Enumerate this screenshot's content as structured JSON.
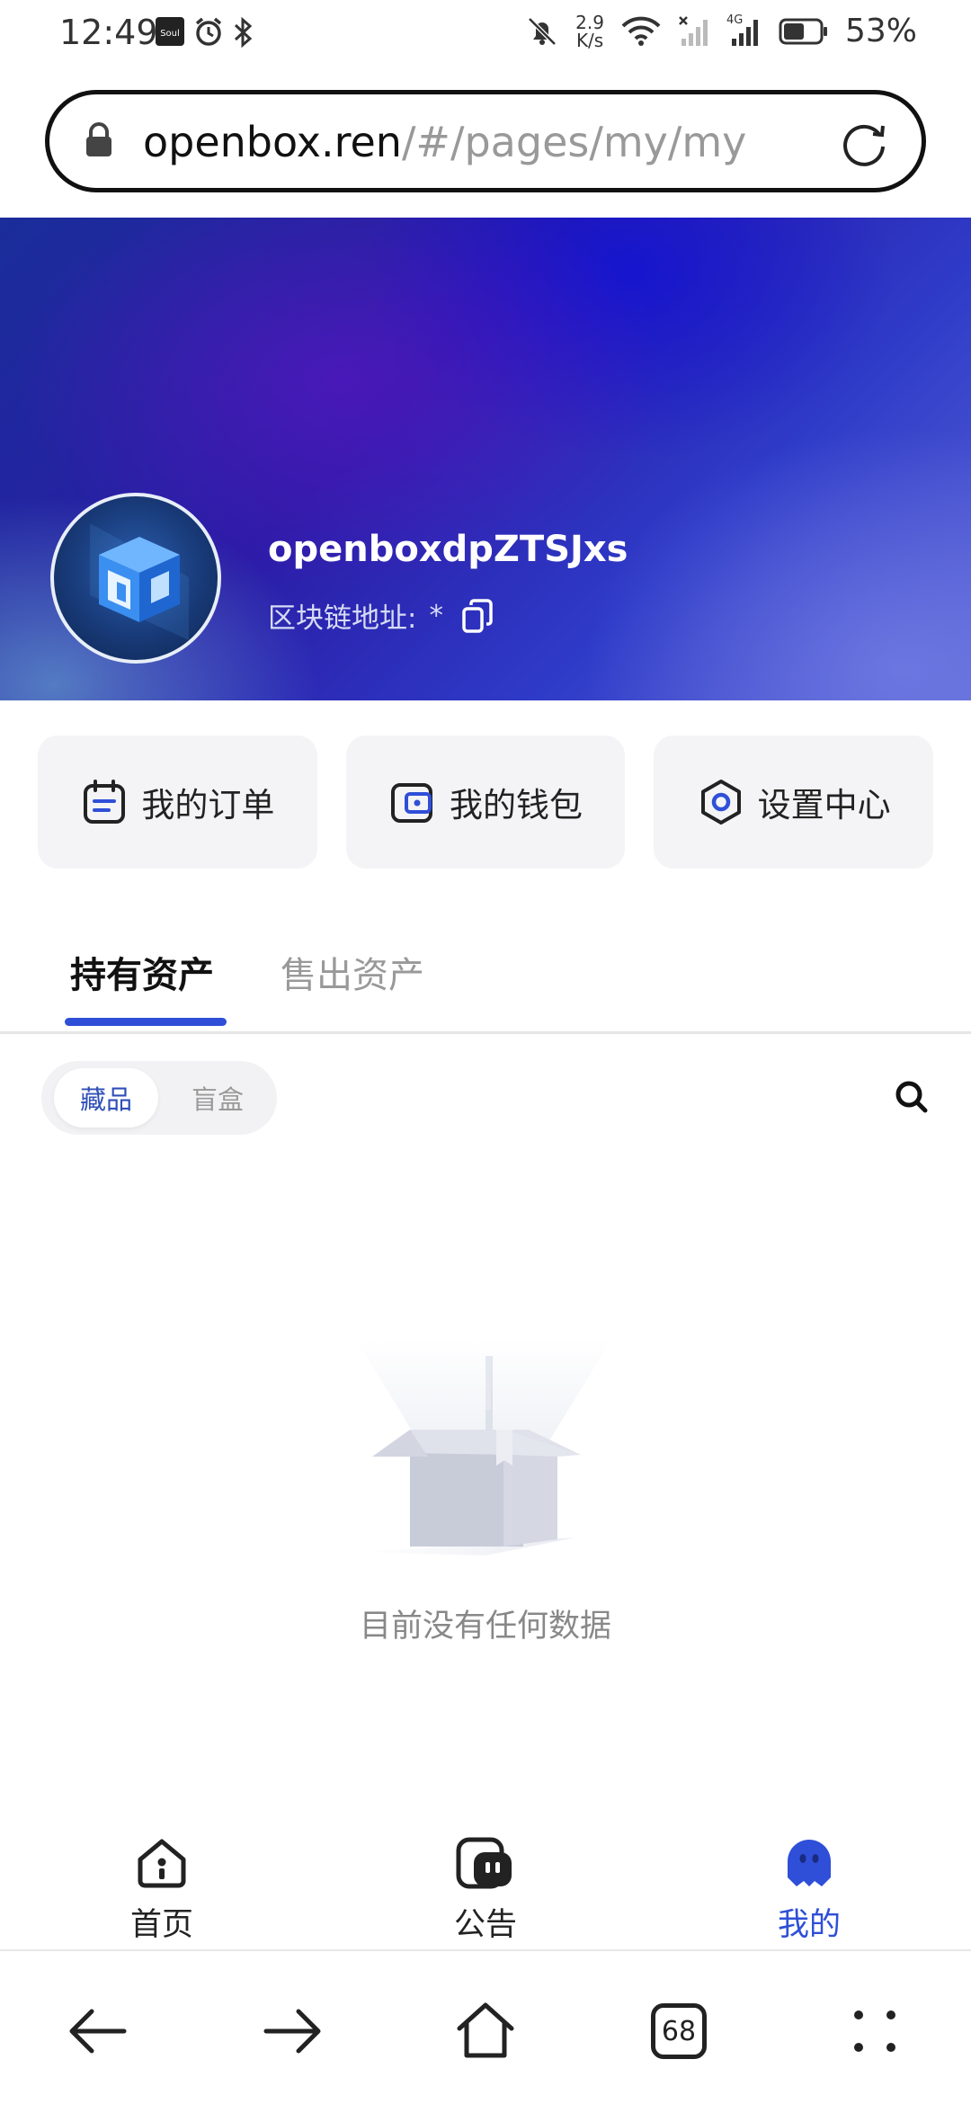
{
  "status_bar": {
    "time": "12:49",
    "net_speed_value": "2.9",
    "net_speed_unit": "K/s",
    "signal_label": "4G",
    "battery_percent": "53%"
  },
  "browser": {
    "url_host": "openbox.ren",
    "url_path": "/#/pages/my/my",
    "tab_count": "68"
  },
  "profile": {
    "username": "openboxdpZTSJxs",
    "chain_address_label": "区块链地址:",
    "chain_address_value": "*"
  },
  "quick_actions": [
    {
      "label": "我的订单",
      "icon": "order-icon"
    },
    {
      "label": "我的钱包",
      "icon": "wallet-icon"
    },
    {
      "label": "设置中心",
      "icon": "settings-icon"
    }
  ],
  "asset_tabs": {
    "active": "持有资产",
    "items": [
      "持有资产",
      "售出资产"
    ]
  },
  "filter": {
    "active": "藏品",
    "items": [
      "藏品",
      "盲盒"
    ]
  },
  "empty_state": {
    "message": "目前没有任何数据"
  },
  "app_nav": {
    "active": "我的",
    "items": [
      {
        "label": "首页",
        "icon": "home-icon"
      },
      {
        "label": "公告",
        "icon": "announcement-icon"
      },
      {
        "label": "我的",
        "icon": "profile-icon"
      }
    ]
  },
  "colors": {
    "accent": "#2f4fd8",
    "muted_text": "#999999",
    "card_bg": "#f4f4f6"
  }
}
